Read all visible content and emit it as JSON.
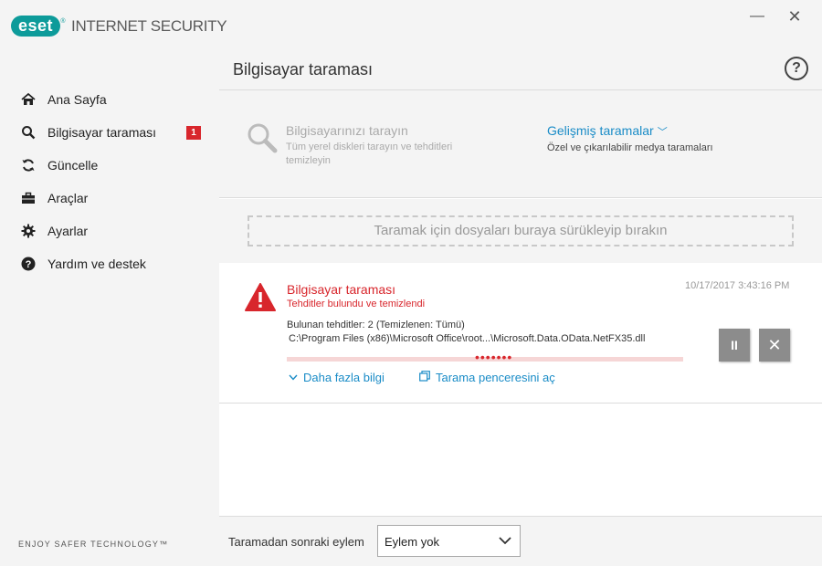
{
  "app": {
    "brand": "eset",
    "product": "INTERNET SECURITY",
    "tagline": "ENJOY SAFER TECHNOLOGY™"
  },
  "window": {
    "minimize": "—",
    "close": "✕"
  },
  "sidebar": {
    "items": [
      {
        "label": "Ana Sayfa",
        "icon": "home-icon"
      },
      {
        "label": "Bilgisayar taraması",
        "icon": "search-icon",
        "badge": "1"
      },
      {
        "label": "Güncelle",
        "icon": "refresh-icon"
      },
      {
        "label": "Araçlar",
        "icon": "toolbox-icon"
      },
      {
        "label": "Ayarlar",
        "icon": "gear-icon"
      },
      {
        "label": "Yardım ve destek",
        "icon": "help-circle-icon"
      }
    ]
  },
  "header": {
    "title": "Bilgisayar taraması",
    "help": "?"
  },
  "scan_options": {
    "computer_scan_title": "Bilgisayarınızı tarayın",
    "computer_scan_desc": "Tüm yerel diskleri tarayın ve tehditleri temizleyin",
    "advanced_title": "Gelişmiş taramalar",
    "advanced_chevron": "﹀",
    "advanced_desc": "Özel ve çıkarılabilir medya taramaları"
  },
  "drop_zone": {
    "text": "Taramak için dosyaları buraya sürükleyip bırakın"
  },
  "scan_result": {
    "title": "Bilgisayar taraması",
    "status": "Tehditler bulundu ve temizlendi",
    "timestamp": "10/17/2017 3:43:16 PM",
    "threats": "Bulunan tehditler: 2 (Temizlenen: Tümü)",
    "path": "C:\\Program Files (x86)\\Microsoft Office\\root...\\Microsoft.Data.OData.NetFX35.dll",
    "progress_dots": "•••••••",
    "pause": "II",
    "stop": "✕",
    "more_info": "Daha fazla bilgi",
    "open_window": "Tarama penceresini aç"
  },
  "bottom": {
    "post_scan_label": "Taramadan sonraki eylem",
    "post_scan_value": "Eylem yok"
  },
  "colors": {
    "accent": "#1a8cc7",
    "danger": "#d8262c",
    "brand": "#0d9b9a"
  }
}
